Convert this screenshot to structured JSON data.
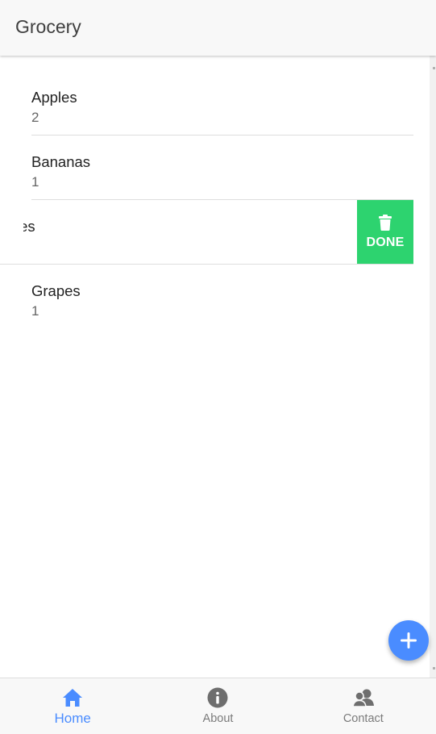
{
  "header": {
    "title": "Grocery"
  },
  "items": [
    {
      "name": "Apples",
      "quantity": "2"
    },
    {
      "name": "Bananas",
      "quantity": "1"
    },
    {
      "name": "Oranges",
      "quantity": "",
      "swiped": true,
      "visible_name_fragment": "ıes"
    },
    {
      "name": "Grapes",
      "quantity": "1"
    }
  ],
  "swipe_action": {
    "label": "DONE",
    "icon": "trash-icon",
    "color": "#2dd36f"
  },
  "fab": {
    "icon": "plus-icon",
    "color": "#4a8cff"
  },
  "tabs": [
    {
      "label": "Home",
      "icon": "home-icon",
      "active": true
    },
    {
      "label": "About",
      "icon": "info-icon",
      "active": false
    },
    {
      "label": "Contact",
      "icon": "people-icon",
      "active": false
    }
  ],
  "colors": {
    "accent": "#4a8cff",
    "success": "#2dd36f",
    "header_bg": "#f8f8f8"
  }
}
